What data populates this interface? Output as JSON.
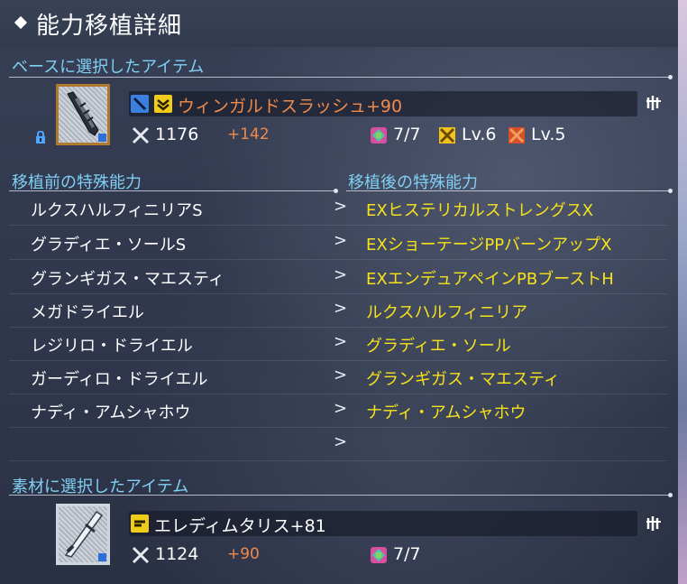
{
  "title": "能力移植詳細",
  "base": {
    "heading": "ベースに選択したアイテム",
    "item_name": "ウィンガルドスラッシュ+90",
    "attack": "1176",
    "attack_bonus": "+142",
    "slots": "7/7",
    "level_a": "Lv.6",
    "level_b": "Lv.5",
    "name_color": "#f08a4a"
  },
  "abilities": {
    "before_heading": "移植前の特殊能力",
    "after_heading": "移植後の特殊能力",
    "arrow": ">",
    "rows": [
      {
        "before": "ルクスハルフィニリアS",
        "after": "EXヒステリカルストレングスX"
      },
      {
        "before": "グラディエ・ソールS",
        "after": "EXショーテージPPバーンアップX"
      },
      {
        "before": "グランギガス・マエスティ",
        "after": "EXエンデュアペインPBブーストH"
      },
      {
        "before": "メガドライエル",
        "after": "ルクスハルフィニリア"
      },
      {
        "before": "レジリロ・ドライエル",
        "after": "グラディエ・ソール"
      },
      {
        "before": "ガーディロ・ドライエル",
        "after": "グランギガス・マエスティ"
      },
      {
        "before": "ナディ・アムシャホウ",
        "after": "ナディ・アムシャホウ"
      },
      {
        "before": "",
        "after": ""
      }
    ],
    "after_color": "#f6e21a"
  },
  "material": {
    "heading": "素材に選択したアイテム",
    "item_name": "エレディムタリス+81",
    "attack": "1124",
    "attack_bonus": "+90",
    "slots": "7/7"
  },
  "colors": {
    "heading": "#7fd0f2",
    "bonus": "#f08a4a",
    "thumb_border": "#b07a2e"
  },
  "icons": [
    "lock-icon",
    "weapon-type-icon",
    "rarity-icon",
    "attack-icon",
    "slot-gem-icon",
    "level-gem-icon",
    "menu-icon",
    "sword-icon",
    "arrow-right-icon"
  ]
}
